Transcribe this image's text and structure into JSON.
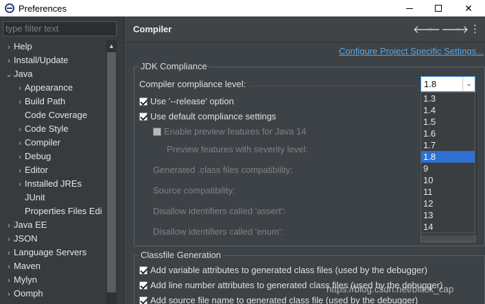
{
  "window": {
    "title": "Preferences",
    "minimize_icon": "minimize-icon",
    "maximize_icon": "maximize-icon",
    "close_glyph": "✕"
  },
  "sidebar": {
    "filter_placeholder": "type filter text",
    "items": [
      {
        "label": "Help",
        "arrow": "›",
        "level": 0
      },
      {
        "label": "Install/Update",
        "arrow": "›",
        "level": 0
      },
      {
        "label": "Java",
        "arrow": "⌄",
        "level": 0
      },
      {
        "label": "Appearance",
        "arrow": "›",
        "level": 1
      },
      {
        "label": "Build Path",
        "arrow": "›",
        "level": 1
      },
      {
        "label": "Code Coverage",
        "arrow": "",
        "level": 1
      },
      {
        "label": "Code Style",
        "arrow": "›",
        "level": 1
      },
      {
        "label": "Compiler",
        "arrow": "›",
        "level": 1
      },
      {
        "label": "Debug",
        "arrow": "›",
        "level": 1
      },
      {
        "label": "Editor",
        "arrow": "›",
        "level": 1
      },
      {
        "label": "Installed JREs",
        "arrow": "›",
        "level": 1
      },
      {
        "label": "JUnit",
        "arrow": "",
        "level": 1
      },
      {
        "label": "Properties Files Edi",
        "arrow": "",
        "level": 1
      },
      {
        "label": "Java EE",
        "arrow": "›",
        "level": 0
      },
      {
        "label": "JSON",
        "arrow": "›",
        "level": 0
      },
      {
        "label": "Language Servers",
        "arrow": "›",
        "level": 0
      },
      {
        "label": "Maven",
        "arrow": "›",
        "level": 0
      },
      {
        "label": "Mylyn",
        "arrow": "›",
        "level": 0
      },
      {
        "label": "Oomph",
        "arrow": "›",
        "level": 0
      }
    ]
  },
  "header": {
    "title": "Compiler",
    "back_glyph": "🡐",
    "forward_glyph": "🡒",
    "dropdown_glyph": "▾",
    "menu_glyph": "⋮"
  },
  "main": {
    "configure_link": "Configure Project Specific Settings...",
    "jdk_group": {
      "legend": "JDK Compliance",
      "compliance_label": "Compiler compliance level:",
      "compliance_value": "1.8",
      "release_label": "Use '--release' option",
      "default_settings_label": "Use default compliance settings",
      "preview_label": "Enable preview features for Java 14",
      "preview_severity_label": "Preview features with severity level:",
      "class_compat_label": "Generated .class files compatibility:",
      "source_compat_label": "Source compatibility:",
      "assert_label": "Disallow identifiers called 'assert':",
      "enum_label": "Disallow identifiers called 'enum':"
    },
    "dropdown_options": [
      "1.3",
      "1.4",
      "1.5",
      "1.6",
      "1.7",
      "1.8",
      "9",
      "10",
      "11",
      "12",
      "13",
      "14"
    ],
    "dropdown_selected": "1.8",
    "classfile_group": {
      "legend": "Classfile Generation",
      "variable_attr_label": "Add variable attributes to generated class files (used by the debugger)",
      "line_number_label": "Add line number attributes to generated class files (used by the debugger)",
      "source_file_label": "Add source file name to generated class file (used by the debugger)"
    }
  },
  "watermark": "https://blog.csdn.net/black_cap",
  "colors": {
    "link": "#59a7e4",
    "selection": "#2f6fd1",
    "background": "#3d4246"
  }
}
